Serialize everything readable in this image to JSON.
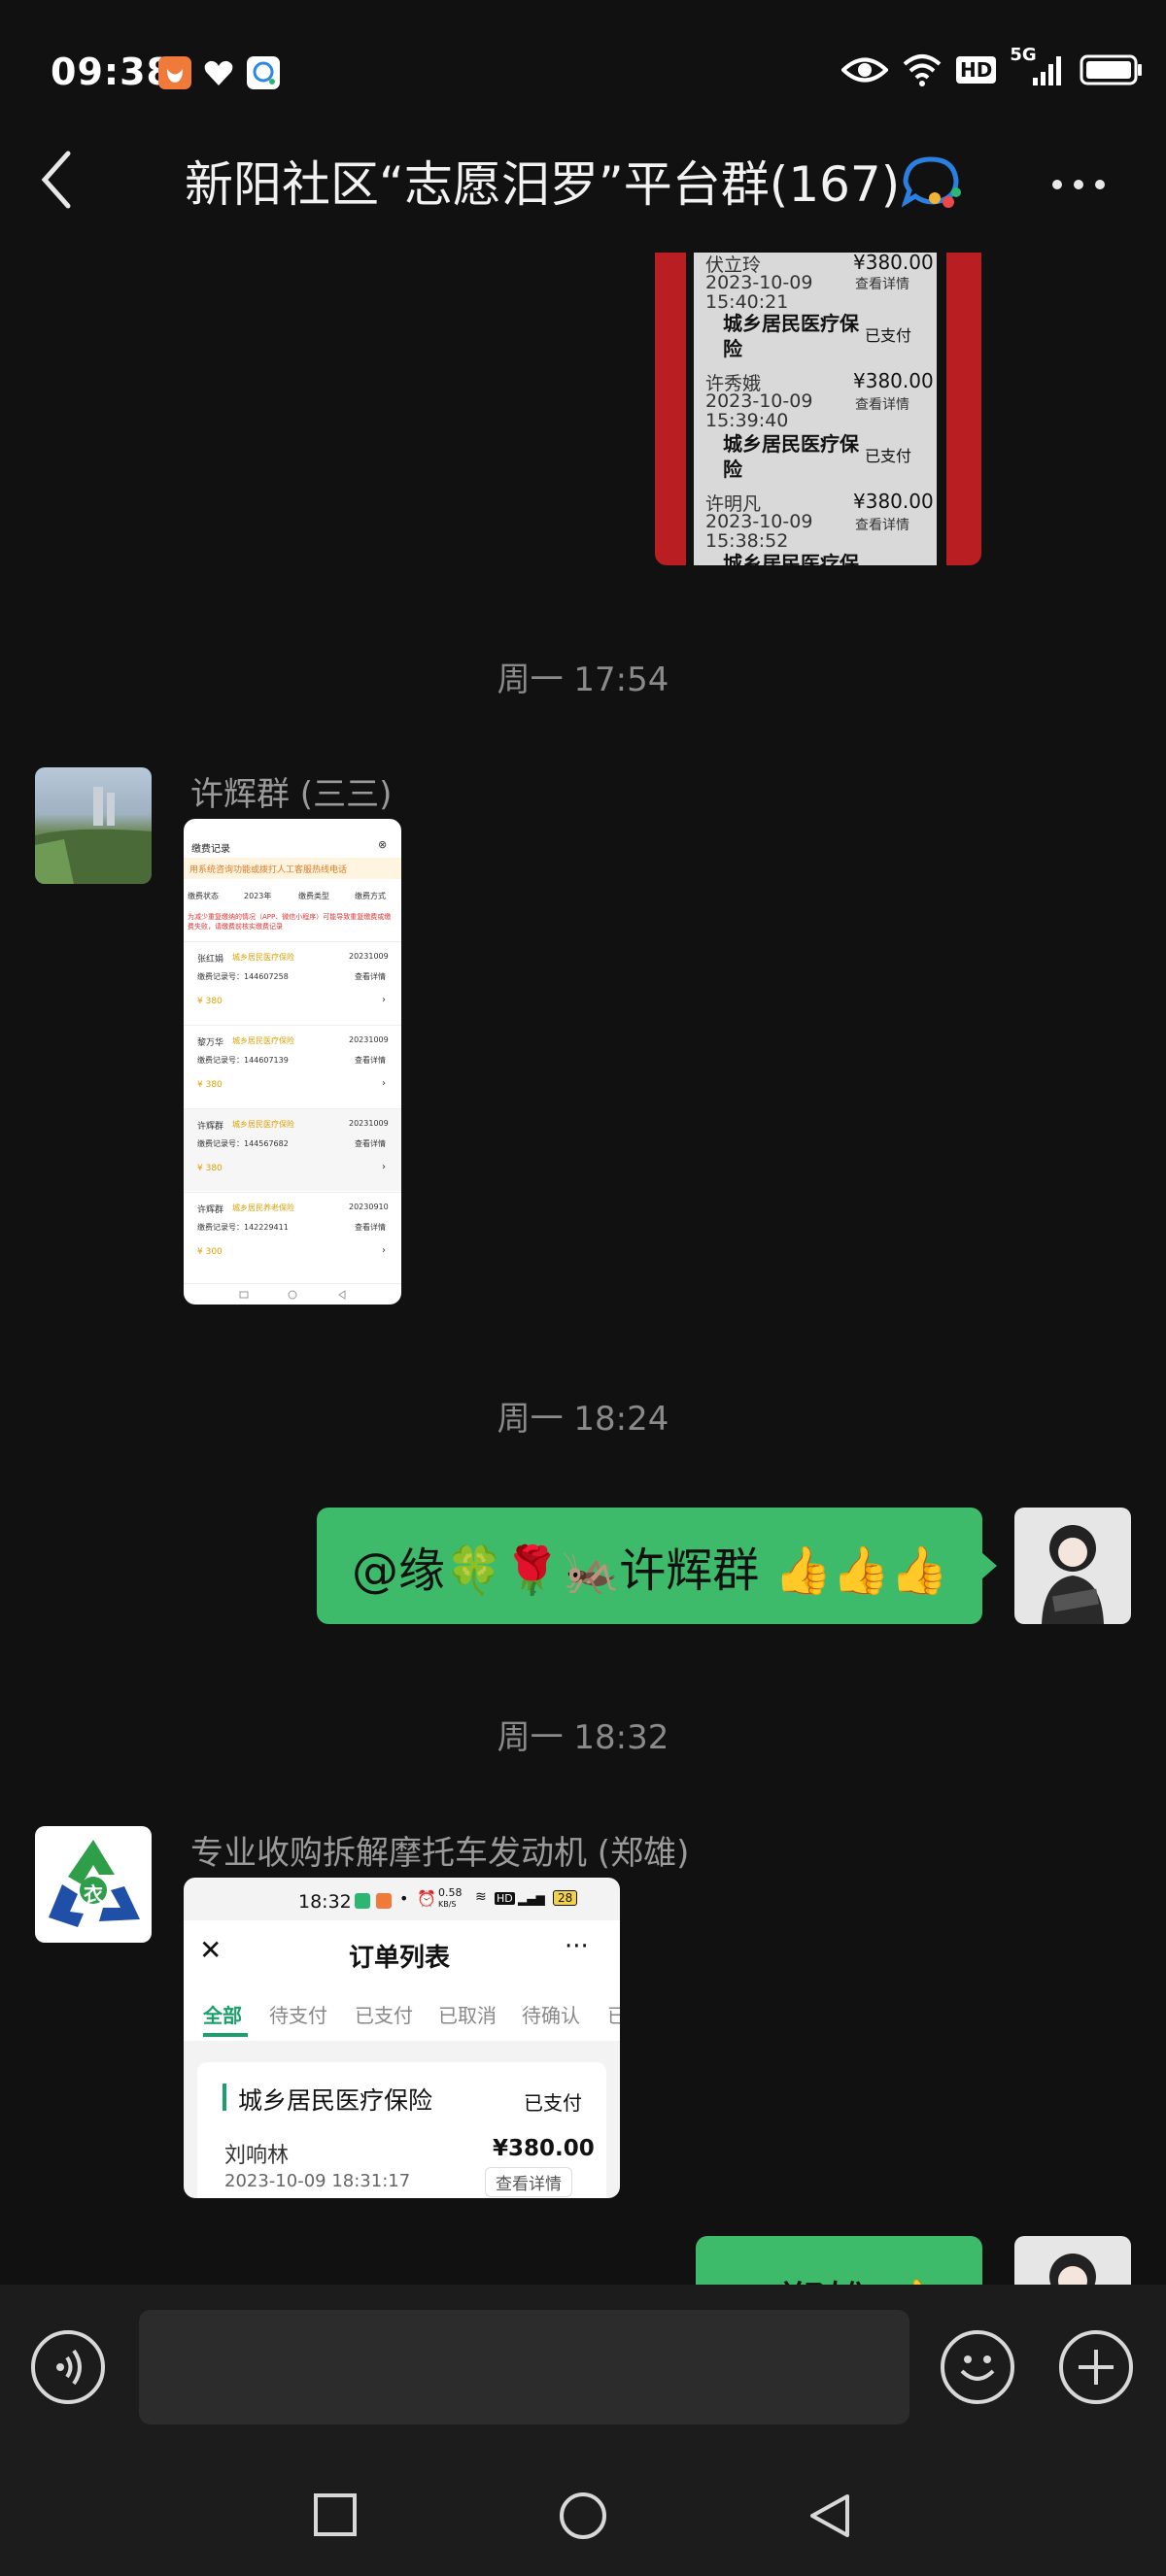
{
  "status_bar": {
    "time": "09:38",
    "network_label": "HD",
    "network_gen": "5G"
  },
  "header": {
    "title": "新阳社区“志愿汨罗”平台群(167)"
  },
  "chat": {
    "first_image": {
      "rows": [
        {
          "name": "伏立玲",
          "amount": "¥380.00",
          "date": "2023-10-09",
          "time": "15:40:21",
          "action": "查看详情"
        },
        {
          "category": "城乡居民医疗保险",
          "status": "已支付"
        },
        {
          "name": "许秀娥",
          "amount": "¥380.00",
          "date": "2023-10-09",
          "time": "15:39:40",
          "action": "查看详情"
        },
        {
          "category": "城乡居民医疗保险",
          "status": "已支付"
        },
        {
          "name": "许明凡",
          "amount": "¥380.00",
          "date": "2023-10-09",
          "time": "15:38:52",
          "action": "查看详情"
        },
        {
          "category": "城乡居民医疗保"
        }
      ]
    },
    "ts1": "周一 17:54",
    "msg1": {
      "sender": "许辉群 (三三)",
      "thumb": {
        "title": "缴费记录",
        "banner": "用系统咨询功能或拨打人工客服热线电话",
        "filters": [
          "缴费状态",
          "2023年",
          "缴费类型",
          "缴费方式"
        ],
        "note": "为减少重复缴纳的情况（APP、微信小程序）可能导致重复缴费或缴费失败，请缴费前核实缴费记录",
        "items": [
          {
            "name": "张红娟",
            "tag": "城乡居民医疗保险",
            "date": "20231009",
            "id": "缴费记录号：144607258",
            "status": "查看详情",
            "amount": "¥ 380"
          },
          {
            "name": "黎万华",
            "tag": "城乡居民医疗保险",
            "date": "20231009",
            "id": "缴费记录号：144607139",
            "status": "查看详情",
            "amount": "¥ 380"
          },
          {
            "name": "许辉群",
            "tag": "城乡居民医疗保险",
            "date": "20231009",
            "id": "缴费记录号：144567682",
            "status": "查看详情",
            "amount": "¥ 380"
          },
          {
            "name": "许辉群",
            "tag": "城乡居民养老保险",
            "date": "20230910",
            "id": "缴费记录号：142229411",
            "status": "查看详情",
            "amount": "¥ 300"
          }
        ]
      }
    },
    "ts2": "周一 18:24",
    "msg2": {
      "text": "@缘🍀🌹🦗许辉群 👍👍👍"
    },
    "ts3": "周一 18:32",
    "msg3": {
      "sender": "专业收购拆解摩托车发动机 (郑雄)",
      "logo_char": "衣",
      "shot": {
        "time": "18:32",
        "speed": "0.58",
        "speed_unit": "KB/S",
        "net": "HD",
        "battery": "28",
        "title": "订单列表",
        "tabs": [
          "全部",
          "待支付",
          "已支付",
          "已取消",
          "待确认",
          "已"
        ],
        "category": "城乡居民医疗保险",
        "status": "已支付",
        "name": "刘响林",
        "amount": "¥380.00",
        "datetime": "2023-10-09 18:31:17",
        "action": "查看详情"
      }
    },
    "msg4": {
      "text": "@郑雄 👍"
    }
  }
}
